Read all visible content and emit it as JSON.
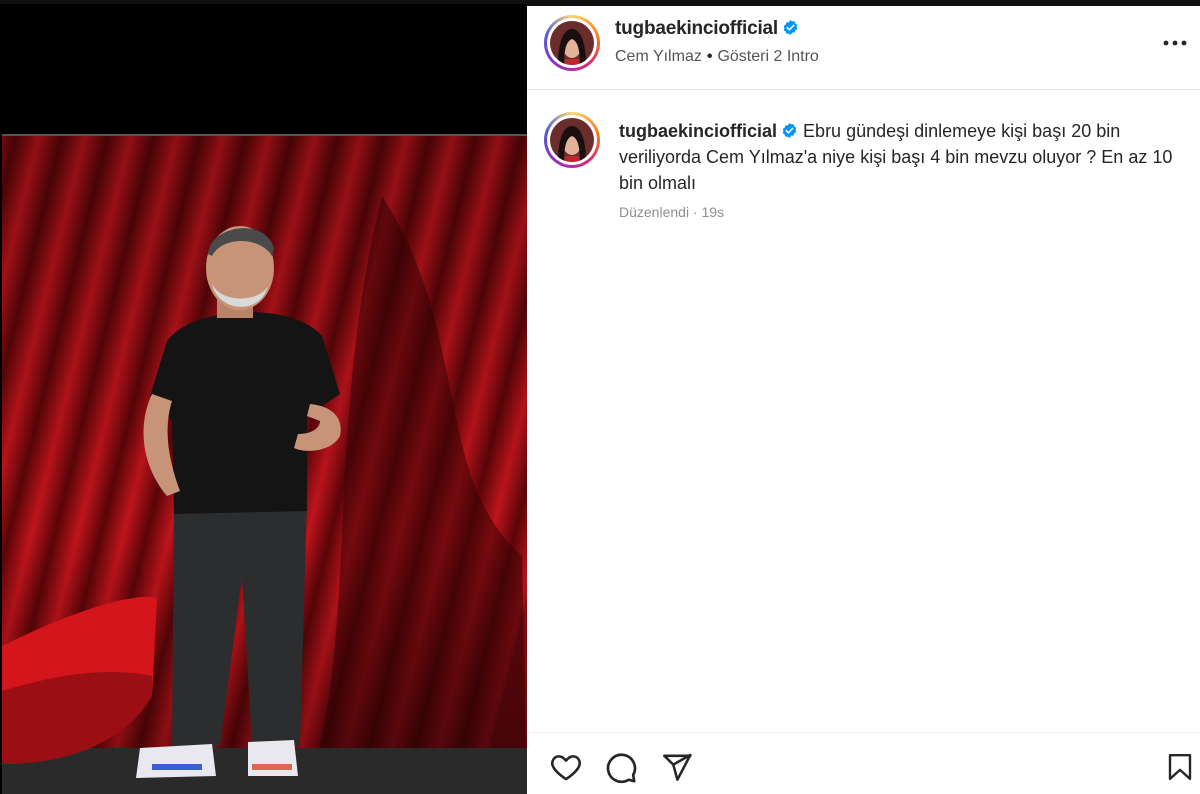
{
  "post": {
    "username": "tugbaekinciofficial",
    "location_parts": [
      "Cem Yılmaz",
      "Gösteri 2 Intro"
    ],
    "location_separator": "•"
  },
  "caption": {
    "username": "tugbaekinciofficial",
    "text": "Ebru gündeşi dinlemeye kişi başı 20 bin veriliyorda Cem Yılmaz'a niye kişi başı 4 bin mevzu oluyor ? En az 10 bin olmalı",
    "meta": "Düzenlendi · 19s"
  },
  "icons": {
    "verified": "verified-badge-icon",
    "more": "more-options-icon",
    "like": "heart-icon",
    "comment": "comment-icon",
    "share": "send-icon",
    "save": "bookmark-icon"
  },
  "colors": {
    "verified_blue": "#0095f6",
    "text_primary": "#262626",
    "text_secondary": "#8e8e8e",
    "curtain_red": "#b3121a",
    "stage_floor": "#2a2a2a"
  }
}
